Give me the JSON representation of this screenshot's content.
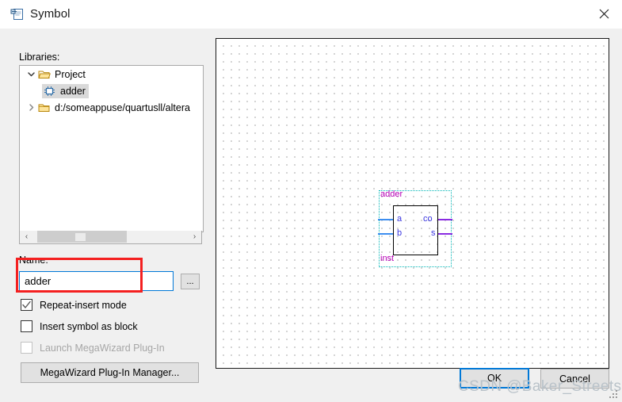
{
  "window": {
    "title": "Symbol",
    "title_icon": "symbol-document-icon",
    "close_icon": "close-icon"
  },
  "left_pane": {
    "libraries_label": "Libraries:",
    "tree": [
      {
        "label": "Project",
        "level": 0,
        "icon": "open-folder-icon",
        "twisty": "chevron-down-icon",
        "expanded": true,
        "selected": false
      },
      {
        "label": "adder",
        "level": 1,
        "icon": "symbol-block-icon",
        "twisty": "",
        "expanded": false,
        "selected": true
      },
      {
        "label": "d:/someappuse/quartusll/altera",
        "level": 0,
        "icon": "closed-folder-icon",
        "twisty": "chevron-right-icon",
        "expanded": false,
        "selected": false
      }
    ],
    "scrollbar": {
      "left_arrow": "‹",
      "right_arrow": "›"
    },
    "name_label": "Name:",
    "name_value": "adder",
    "name_placeholder": "",
    "browse_label": "...",
    "checkboxes": [
      {
        "label": "Repeat-insert mode",
        "checked": true,
        "disabled": false
      },
      {
        "label": "Insert symbol as block",
        "checked": false,
        "disabled": false
      },
      {
        "label": "Launch MegaWizard Plug-In",
        "checked": false,
        "disabled": true
      }
    ],
    "megawizard_button": "MegaWizard Plug-In Manager..."
  },
  "canvas": {
    "symbol": {
      "title": "adder",
      "instance": "inst",
      "inputs": [
        "a",
        "b"
      ],
      "outputs": [
        "co",
        "s"
      ]
    }
  },
  "footer": {
    "ok_label": "OK",
    "cancel_label": "Cancel"
  },
  "watermark": "CSDN @Baker_Streets",
  "colors": {
    "accent": "#0078d7",
    "annotation": "#f42020",
    "symbol_label": "#b500b5",
    "symbol_port": "#3a36e0",
    "wire_in": "#3d8ef0",
    "wire_out": "#8a2be2",
    "selection_border": "#00b7b7"
  }
}
